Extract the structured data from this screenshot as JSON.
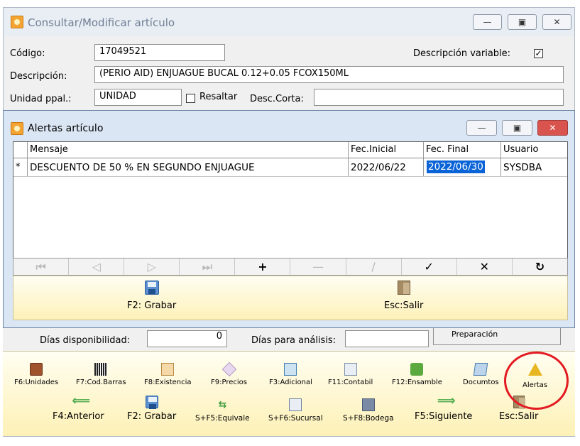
{
  "outer_window": {
    "title": "Consultar/Modificar artículo",
    "fields": {
      "codigo_label": "Código:",
      "codigo_value": "17049521",
      "desc_variable_label": "Descripción variable:",
      "desc_variable_checked": "✓",
      "descripcion_label": "Descripción:",
      "descripcion_value": "(PERIO AID) ENJUAGUE BUCAL 0.12+0.05 FCOX150ML",
      "unidad_label": "Unidad ppal.:",
      "unidad_value": "UNIDAD",
      "resaltar_label": "Resaltar",
      "desc_corta_label": "Desc.Corta:",
      "desc_corta_value": ""
    },
    "dias_disponibilidad_label": "Días disponibilidad:",
    "dias_disponibilidad_value": "0",
    "dias_analisis_label": "Días para análisis:",
    "dias_analisis_value": "",
    "preparacion_label": "Preparación"
  },
  "alert_window": {
    "title": "Alertas artículo",
    "columns": [
      "Mensaje",
      "Fec.Inicial",
      "Fec. Final",
      "Usuario"
    ],
    "rows": [
      {
        "marker": "*",
        "mensaje": "DESCUENTO DE 50 % EN SEGUNDO ENJUAGUE",
        "fec_inicial": "2022/06/22",
        "fec_final": "2022/06/30",
        "usuario": "SYSDBA"
      }
    ],
    "nav_buttons": [
      "⏮",
      "◁",
      "▷",
      "⏭",
      "+",
      "—",
      "∕",
      "✓",
      "✕",
      "↻"
    ],
    "save_label": "F2: Grabar",
    "exit_label": "Esc:Salir"
  },
  "toolbar_row1": [
    {
      "label": "F6:Unidades",
      "icon": "box-icon"
    },
    {
      "label": "F7:Cod.Barras",
      "icon": "barcode-icon"
    },
    {
      "label": "F8:Existencia",
      "icon": "clipboard-icon"
    },
    {
      "label": "F9:Precios",
      "icon": "price-tag-icon"
    },
    {
      "label": "F3:Adicional",
      "icon": "sheet-icon"
    },
    {
      "label": "F11:Contabil",
      "icon": "calculator-icon"
    },
    {
      "label": "F12:Ensamble",
      "icon": "puzzle-icon"
    },
    {
      "label": "Documtos",
      "icon": "document-icon"
    },
    {
      "label": "Alertas",
      "icon": "warning-icon"
    }
  ],
  "toolbar_row2": [
    {
      "label": "F4:Anterior",
      "icon": "arrow-left-icon"
    },
    {
      "label": "F2: Grabar",
      "icon": "save-icon"
    },
    {
      "label": "S+F5:Equivale",
      "icon": "equivalent-icon"
    },
    {
      "label": "S+F6:Sucursal",
      "icon": "branch-icon"
    },
    {
      "label": "S+F8:Bodega",
      "icon": "warehouse-icon"
    },
    {
      "label": "F5:Siguiente",
      "icon": "arrow-right-icon"
    },
    {
      "label": "Esc:Salir",
      "icon": "exit-door-icon"
    }
  ],
  "colors": {
    "toolbar_yellow": "#fdf1b6",
    "selection_blue": "#0a64d8",
    "annotation_red": "#e31b23"
  }
}
